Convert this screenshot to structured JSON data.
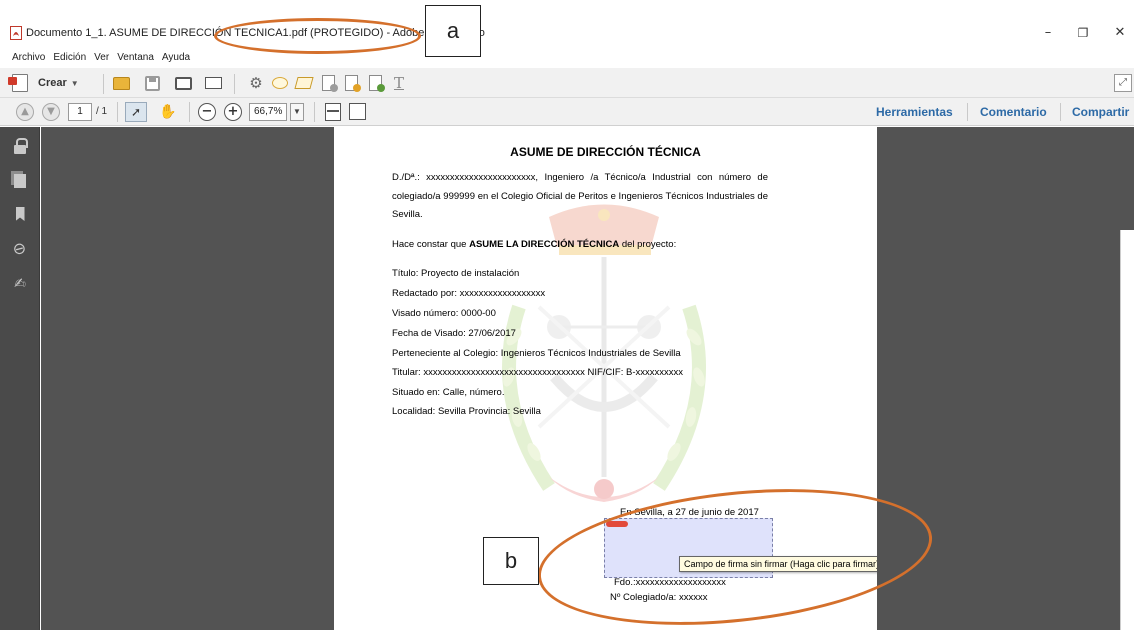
{
  "window": {
    "title": "Documento 1_1. ASUME DE DIRECCIÓN TECNICA1.pdf (PROTEGIDO) - Adobe Acrobat Pro",
    "min_label": "–",
    "restore_label": "❐",
    "close_label": "✕"
  },
  "menu": [
    "Archivo",
    "Edición",
    "Ver",
    "Ventana",
    "Ayuda"
  ],
  "toolbar": {
    "crear_label": "Crear",
    "tools_icons": [
      "open-icon",
      "save-icon",
      "print-icon",
      "email-icon",
      "settings-icon",
      "comment-icon",
      "highlight-icon",
      "doc-icon",
      "export-icon",
      "share-icon",
      "text-icon"
    ]
  },
  "navbar": {
    "page_current": "1",
    "page_total": "/ 1",
    "zoom": "66,7%",
    "tabs": [
      "Herramientas",
      "Comentario",
      "Compartir"
    ]
  },
  "document": {
    "title": "ASUME DE DIRECCIÓN TÉCNICA",
    "intro": "D./Dª.: xxxxxxxxxxxxxxxxxxxxxxx, Ingeniero /a Técnico/a Industrial con número de colegiado/a 999999 en el Colegio Oficial de Peritos e Ingenieros Técnicos Industriales de Sevilla.",
    "statement_prefix": "Hace constar que ",
    "statement_bold": "ASUME LA DIRECCIÓN TÉCNICA",
    "statement_suffix": " del proyecto:",
    "fields": [
      "Título: Proyecto de instalación",
      "Redactado por: xxxxxxxxxxxxxxxxxx",
      "Visado número: 0000-00",
      "Fecha de Visado: 27/06/2017",
      "Perteneciente al Colegio: Ingenieros Técnicos Industriales de Sevilla",
      "Titular: xxxxxxxxxxxxxxxxxxxxxxxxxxxxxxxxxx   NIF/CIF: B-xxxxxxxxxx",
      "Situado en: Calle, número.",
      "Localidad: Sevilla    Provincia: Sevilla"
    ],
    "sign_date": "En Sevilla, a 27 de junio de 2017",
    "sign_name": "Fdo.:xxxxxxxxxxxxxxxxxxx",
    "sign_colegiado": "Nº Colegiado/a: xxxxxx",
    "tooltip": "Campo de firma sin firmar (Haga clic para firmar)"
  },
  "annotations": {
    "a": "a",
    "b": "b",
    "color": "#d4702c"
  },
  "colors": {
    "accent_link": "#2d6aa6",
    "signature_field": "#dfe2fb",
    "canvas": "#535353",
    "nav": "#4a4a4a"
  }
}
